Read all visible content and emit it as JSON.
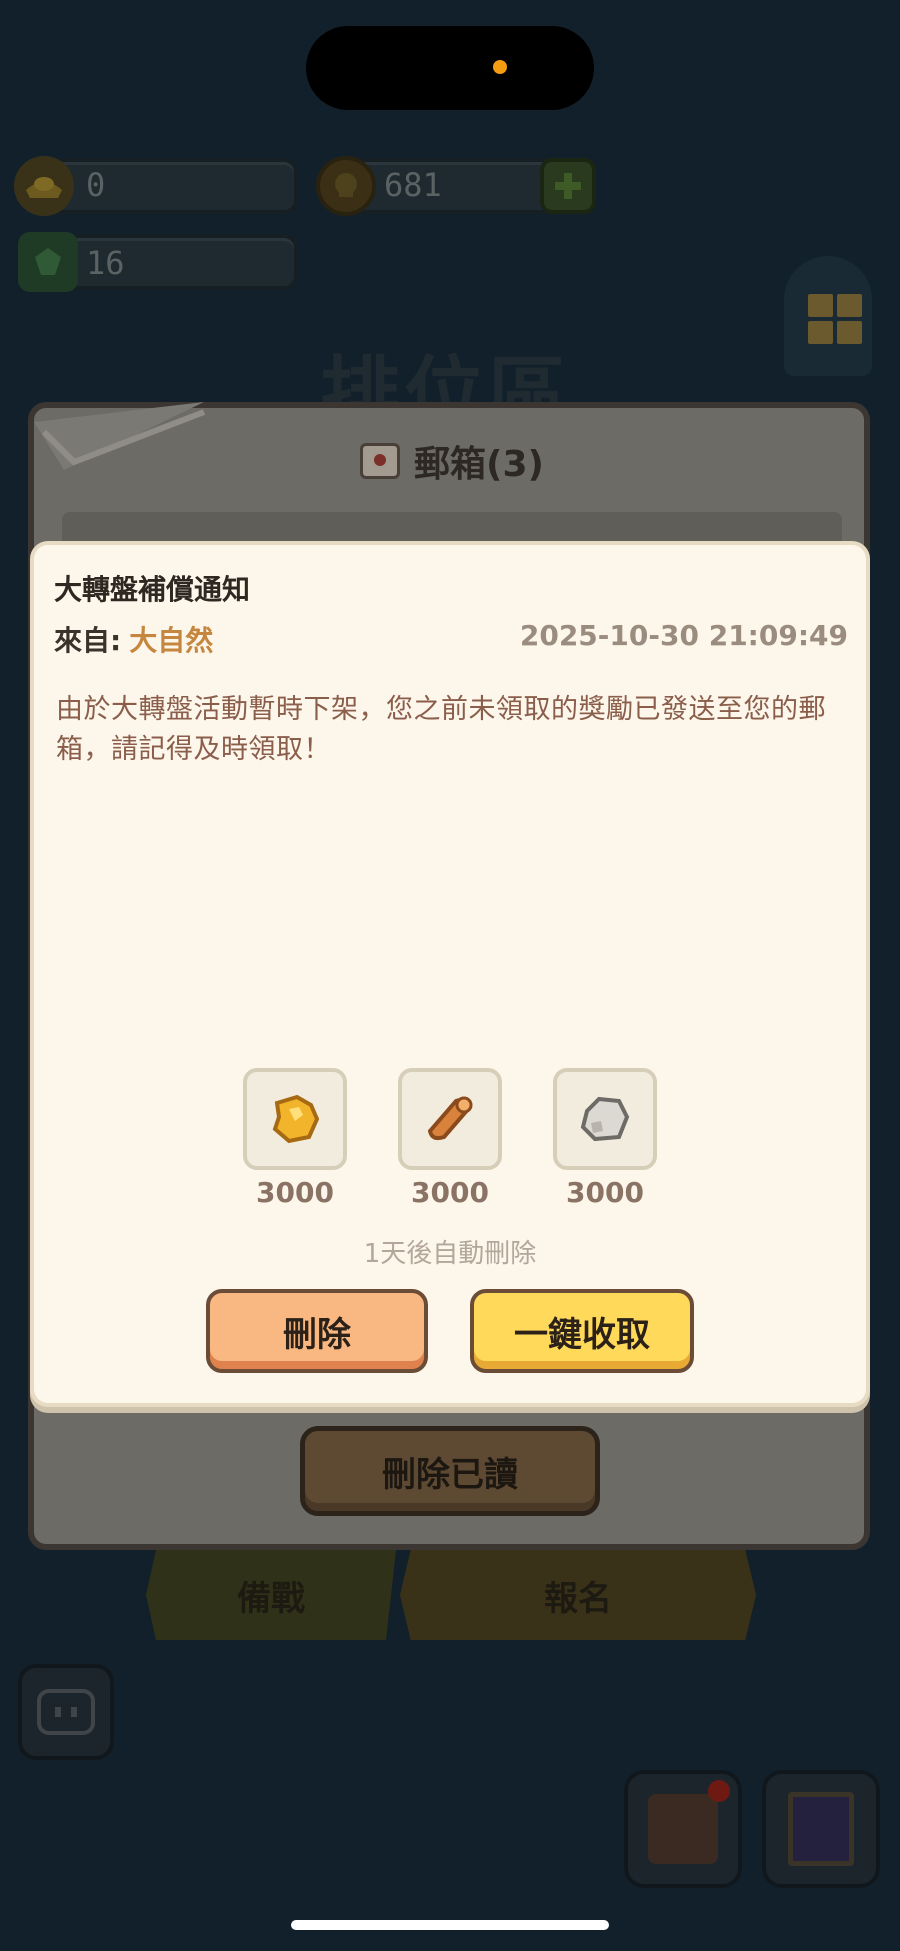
{
  "resources": {
    "gold_ingot": "0",
    "coin": "681",
    "gem": "16"
  },
  "background": {
    "area_title": "排位區",
    "mailbox_title": "郵箱(3)",
    "delete_read_label": "刪除已讀",
    "tabs": [
      "備戰",
      "報名"
    ]
  },
  "mail": {
    "title": "大轉盤補償通知",
    "from_label": "來自:",
    "sender": "大自然",
    "timestamp": "2025-10-30 21:09:49",
    "body": "由於大轉盤活動暫時下架，您之前未領取的獎勵已發送至您的郵箱，請記得及時領取！",
    "rewards": [
      {
        "icon": "gold-ore-icon",
        "amount": "3000"
      },
      {
        "icon": "wood-log-icon",
        "amount": "3000"
      },
      {
        "icon": "stone-icon",
        "amount": "3000"
      }
    ],
    "auto_delete_note": "1天後自動刪除",
    "delete_button": "刪除",
    "collect_button": "一鍵收取"
  },
  "colors": {
    "modal_bg": "#fdf6ea",
    "sender": "#c5873f",
    "body_text": "#8b5e4c",
    "delete_button": "#f9b882",
    "collect_button": "#ffd95a"
  }
}
